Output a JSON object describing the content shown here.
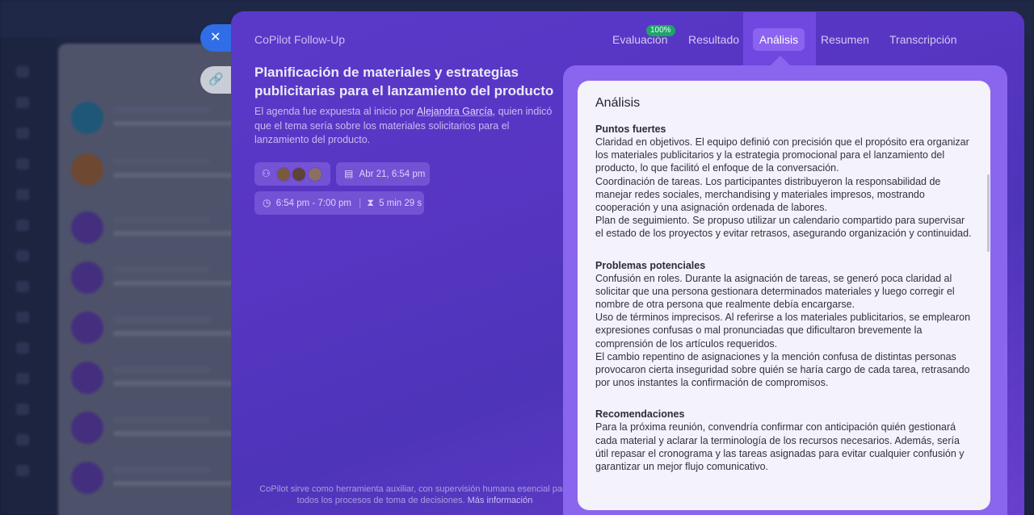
{
  "modal": {
    "title": "CoPilot Follow-Up",
    "tabs": [
      {
        "label": "Evaluación",
        "badge": "100%"
      },
      {
        "label": "Resultado"
      },
      {
        "label": "Análisis",
        "active": true
      },
      {
        "label": "Resumen"
      },
      {
        "label": "Transcripción"
      }
    ]
  },
  "meeting": {
    "title": "Planificación de materiales y estrategias publicitarias para el lanzamiento del producto",
    "agenda_prefix": "El agenda fue expuesta al inicio por ",
    "agenda_name": "Alejandra García",
    "agenda_suffix": ", quien indicó que el tema sería sobre los materiales solicitarios para el lanzamiento del producto.",
    "date": "Abr 21, 6:54 pm",
    "time_range": "6:54 pm - 7:00 pm",
    "duration": "5 min 29 s"
  },
  "footer": {
    "note": "CoPilot sirve como herramienta auxiliar, con supervisión humana esencial para todos los procesos de toma de decisiones.",
    "more_link": "Más información"
  },
  "analysis": {
    "heading": "Análisis",
    "sections": [
      {
        "title": "Puntos fuertes",
        "paragraphs": [
          "Claridad en objetivos. El equipo definió con precisión que el propósito era organizar los materiales publicitarios y la estrategia promocional para el lanzamiento del producto, lo que facilitó el enfoque de la conversación.",
          "Coordinación de tareas. Los participantes distribuyeron la responsabilidad de manejar redes sociales, merchandising y materiales impresos, mostrando cooperación y una asignación ordenada de labores.",
          "Plan de seguimiento. Se propuso utilizar un calendario compartido para supervisar el estado de los proyectos y evitar retrasos, asegurando organización y continuidad."
        ]
      },
      {
        "title": "Problemas potenciales",
        "paragraphs": [
          "Confusión en roles. Durante la asignación de tareas, se generó poca claridad al solicitar que una persona gestionara determinados materiales y luego corregir el nombre de otra persona que realmente debía encargarse.",
          "Uso de términos imprecisos. Al referirse a los materiales publicitarios, se emplearon expresiones confusas o mal pronunciadas que dificultaron brevemente la comprensión de los artículos requeridos.",
          "El cambio repentino de asignaciones y la mención confusa de distintas personas provocaron cierta inseguridad sobre quién se haría cargo de cada tarea, retrasando por unos instantes la confirmación de compromisos."
        ]
      },
      {
        "title": "Recomendaciones",
        "paragraphs": [
          "Para la próxima reunión, convendría confirmar con anticipación quién gestionará cada material y aclarar la terminología de los recursos necesarios. Además, sería útil repasar el cronograma y las tareas asignadas para evitar cualquier confusión y garantizar un mejor flujo comunicativo."
        ]
      }
    ]
  },
  "colors": {
    "accent": "#8b63f0",
    "modal_bg": "#5836c4",
    "badge": "#20a36a"
  }
}
